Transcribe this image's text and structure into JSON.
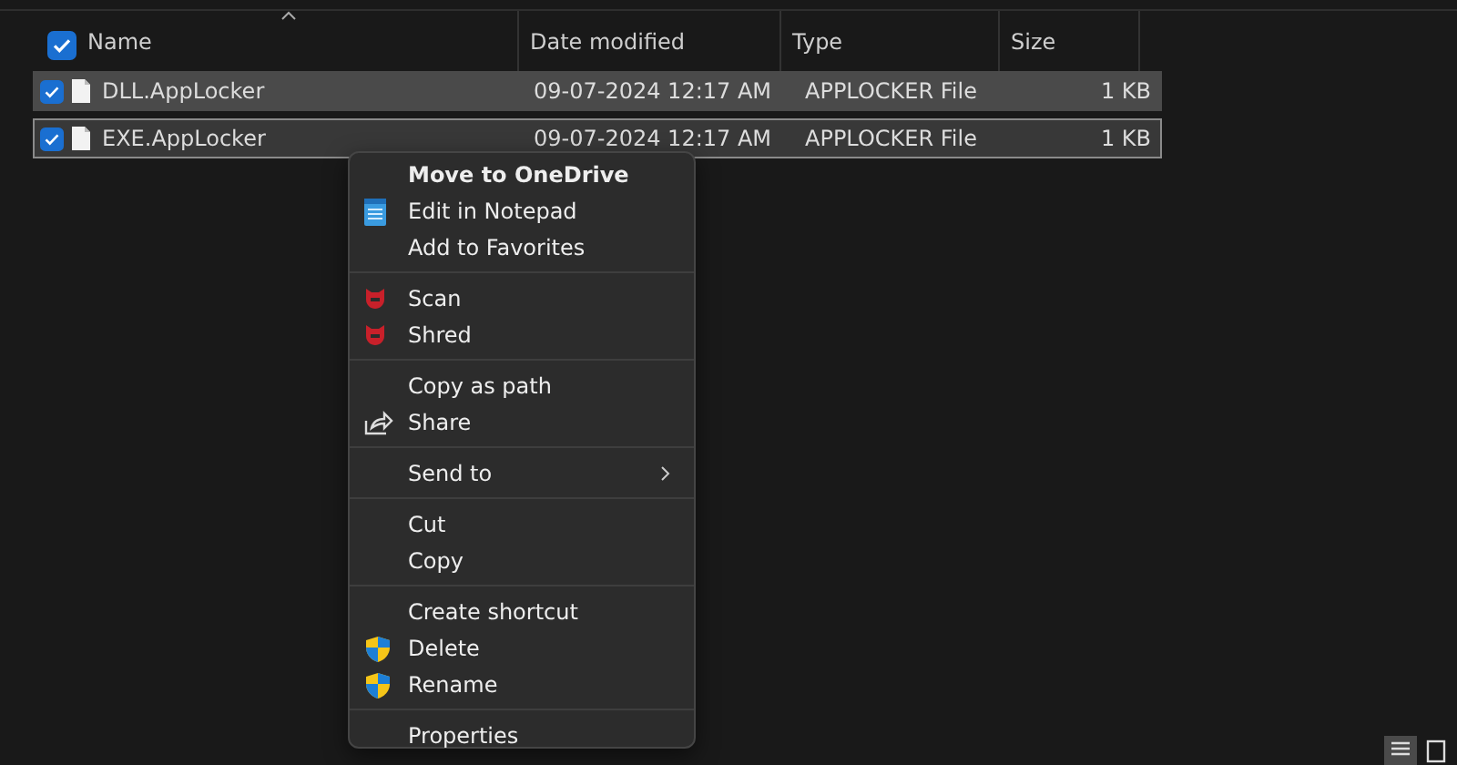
{
  "header": {
    "select_all": {
      "checked": true
    },
    "columns": [
      {
        "label": "Name",
        "sorted": true
      },
      {
        "label": "Date modified",
        "sorted": false
      },
      {
        "label": "Type",
        "sorted": false
      },
      {
        "label": "Size",
        "sorted": false
      }
    ]
  },
  "rows": [
    {
      "name": "DLL.AppLocker",
      "date": "09-07-2024 12:17 AM",
      "type": "APPLOCKER File",
      "size": "1 KB",
      "selected": true,
      "focused": false,
      "checked": true
    },
    {
      "name": "EXE.AppLocker",
      "date": "09-07-2024 12:17 AM",
      "type": "APPLOCKER File",
      "size": "1 KB",
      "selected": true,
      "focused": true,
      "checked": true
    }
  ],
  "context_menu": {
    "sections": [
      {
        "items": [
          {
            "label": "Move to OneDrive",
            "kind": "plain",
            "bold": true,
            "submenu": false
          },
          {
            "label": "Edit in Notepad",
            "kind": "notepad",
            "bold": false,
            "submenu": false
          },
          {
            "label": "Add to Favorites",
            "kind": "plain",
            "bold": false,
            "submenu": false
          }
        ]
      },
      {
        "items": [
          {
            "label": "Scan",
            "kind": "antivirus",
            "bold": false,
            "submenu": false
          },
          {
            "label": "Shred",
            "kind": "antivirus",
            "bold": false,
            "submenu": false
          }
        ]
      },
      {
        "items": [
          {
            "label": "Copy as path",
            "kind": "plain",
            "bold": false,
            "submenu": false
          },
          {
            "label": "Share",
            "kind": "share",
            "bold": false,
            "submenu": false
          }
        ]
      },
      {
        "items": [
          {
            "label": "Send to",
            "kind": "plain",
            "bold": false,
            "submenu": true
          }
        ]
      },
      {
        "items": [
          {
            "label": "Cut",
            "kind": "plain",
            "bold": false,
            "submenu": false
          },
          {
            "label": "Copy",
            "kind": "plain",
            "bold": false,
            "submenu": false
          }
        ]
      },
      {
        "items": [
          {
            "label": "Create shortcut",
            "kind": "plain",
            "bold": false,
            "submenu": false
          },
          {
            "label": "Delete",
            "kind": "uac",
            "bold": false,
            "submenu": false
          },
          {
            "label": "Rename",
            "kind": "uac",
            "bold": false,
            "submenu": false
          }
        ]
      },
      {
        "items": [
          {
            "label": "Properties",
            "kind": "plain",
            "bold": false,
            "submenu": false
          }
        ]
      }
    ]
  },
  "view_buttons": [
    {
      "kind": "details",
      "selected": true
    },
    {
      "kind": "tiles",
      "selected": false
    }
  ]
}
